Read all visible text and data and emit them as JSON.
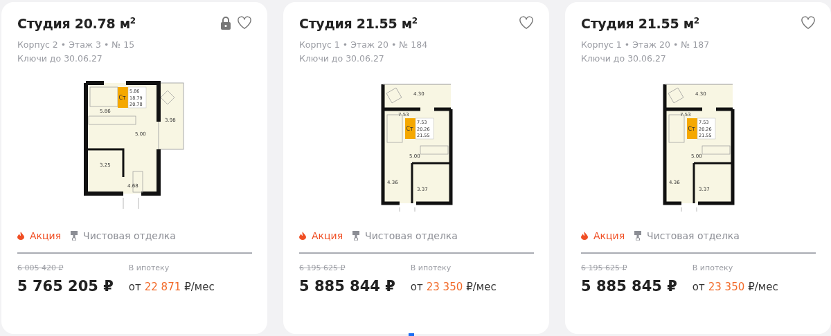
{
  "cards": [
    {
      "title": "Студия 20.78 м$^{2}$",
      "locked": true,
      "favorite": false,
      "meta": [
        "Корпус 2 • Этаж 3 • № 15",
        "Ключи до 30.06.27"
      ],
      "plan": {
        "kind": "corner",
        "badge": "Ст",
        "badge_values": [
          "5.86",
          "18.79",
          "20.78"
        ],
        "rooms": [
          "5.86",
          "5.00",
          "3.98",
          "3.25",
          "4.68"
        ]
      },
      "tags": [
        {
          "kind": "promo",
          "label": "Акция"
        },
        {
          "kind": "finish",
          "label": "Чистовая отделка"
        }
      ],
      "old_price": "6 005 420 ₽",
      "price": "5 765 205 ₽",
      "mortgage_label": "В ипотеку",
      "mortgage_prefix": "от",
      "mortgage_amount": "22 871",
      "mortgage_suffix": "₽/мес"
    },
    {
      "title": "Студия 21.55 м$^{2}$",
      "locked": false,
      "favorite": false,
      "meta": [
        "Корпус 1 • Этаж 20 • № 184",
        "Ключи до 30.06.27"
      ],
      "plan": {
        "kind": "narrow",
        "badge": "Ст",
        "badge_values": [
          "7.53",
          "20.26",
          "21.55"
        ],
        "rooms": [
          "4.30",
          "7.53",
          "5.00",
          "4.36",
          "3.37"
        ]
      },
      "tags": [
        {
          "kind": "promo",
          "label": "Акция"
        },
        {
          "kind": "finish",
          "label": "Чистовая отделка"
        }
      ],
      "old_price": "6 195 625 ₽",
      "price": "5 885 844 ₽",
      "mortgage_label": "В ипотеку",
      "mortgage_prefix": "от",
      "mortgage_amount": "23 350",
      "mortgage_suffix": "₽/мес"
    },
    {
      "title": "Студия 21.55 м$^{2}$",
      "locked": false,
      "favorite": false,
      "meta": [
        "Корпус 1 • Этаж 20 • № 187",
        "Ключи до 30.06.27"
      ],
      "plan": {
        "kind": "narrow",
        "badge": "Ст",
        "badge_values": [
          "7.53",
          "20.26",
          "21.55"
        ],
        "rooms": [
          "4.30",
          "7.53",
          "5.00",
          "4.36",
          "3.37"
        ]
      },
      "tags": [
        {
          "kind": "promo",
          "label": "Акция"
        },
        {
          "kind": "finish",
          "label": "Чистовая отделка"
        }
      ],
      "old_price": "6 195 625 ₽",
      "price": "5 885 845 ₽",
      "mortgage_label": "В ипотеку",
      "mortgage_prefix": "от",
      "mortgage_amount": "23 350",
      "mortgage_suffix": "₽/мес"
    }
  ]
}
